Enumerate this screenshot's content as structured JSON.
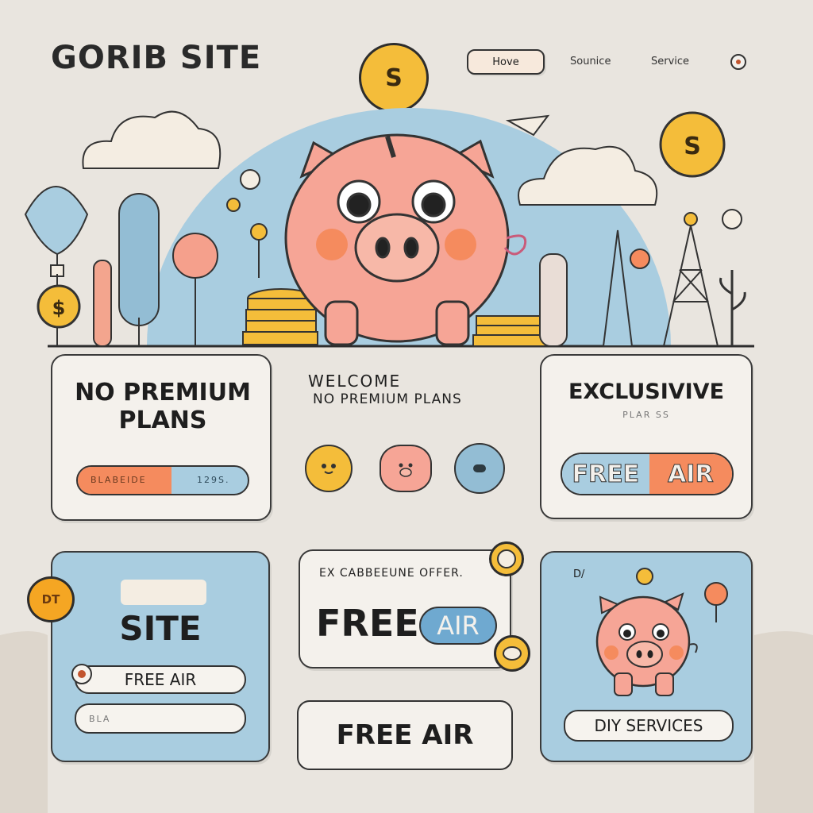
{
  "header": {
    "brand": "GORIB SITE",
    "nav": [
      {
        "label": "Hove"
      },
      {
        "label": "Sounice"
      },
      {
        "label": "Service"
      }
    ],
    "coin_symbol": "S"
  },
  "hero": {
    "coin_symbol": "S"
  },
  "cards": {
    "premium": {
      "title": "NO PREMIUM PLANS",
      "bar_left": "BLABEIDE",
      "bar_right": "129S."
    },
    "welcome": {
      "line1": "WELCOME",
      "line2": "NO PREMIUM PLANS"
    },
    "exclusive": {
      "title": "EXCLUSIVIVE",
      "subtitle": "PLAR SS",
      "btn_left": "FREE",
      "btn_right": "AIR"
    },
    "site": {
      "badge": "DT",
      "title": "SITE",
      "pill1": "FREE AIR",
      "pill2": "BLA"
    },
    "offer": {
      "caption": "EX CABBEEUNE OFFER.",
      "word_free": "FREE",
      "word_air": "AIR"
    },
    "free_air": {
      "label": "FREE AIR"
    },
    "diy": {
      "caption": "D/",
      "label": "DIY SERVICES"
    }
  },
  "colors": {
    "background": "#e9e5df",
    "pig": "#f6a596",
    "sky_blue": "#a9cde0",
    "coin": "#f4bd3a",
    "orange": "#f58b5e"
  }
}
